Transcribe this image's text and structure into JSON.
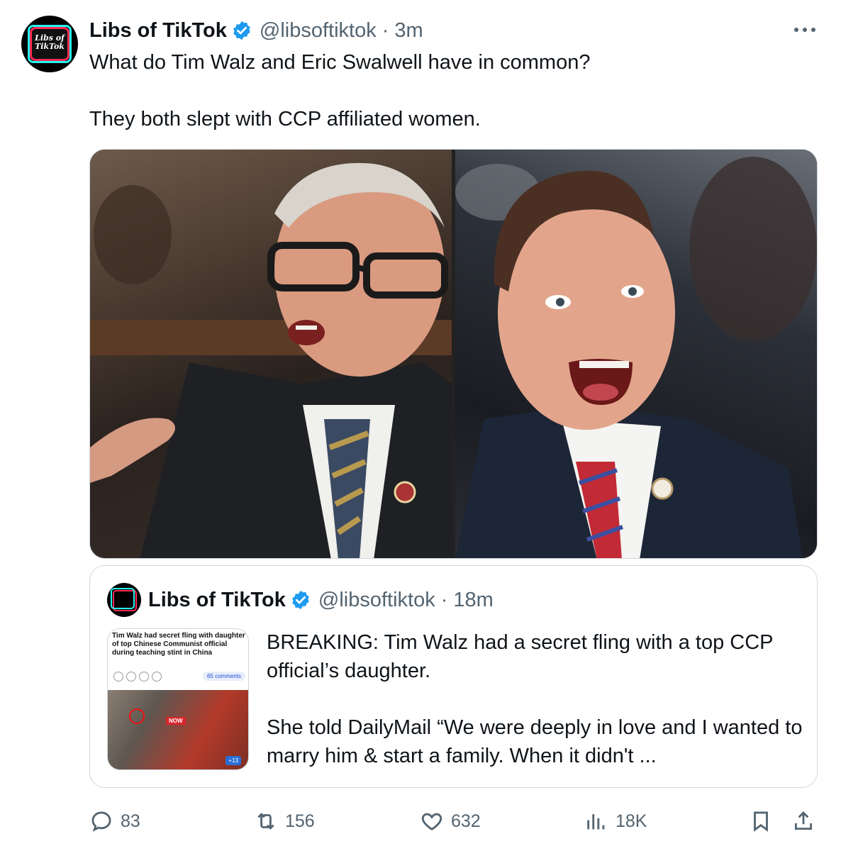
{
  "tweet": {
    "author_name": "Libs of TikTok",
    "handle": "@libsoftiktok",
    "separator": "·",
    "time": "3m",
    "avatar_text": "Libs of TikTok",
    "text_line1": "What do Tim Walz and Eric Swalwell have in common?",
    "text_line2": "They both slept with CCP affiliated women.",
    "more_icon": "more-horizontal-icon",
    "verified_color": "#1d9bf0"
  },
  "media": {
    "left_photo": "photo of a man with glasses in a suit speaking",
    "right_photo": "photo of a man in a suit laughing"
  },
  "quoted_tweet": {
    "author_name": "Libs of TikTok",
    "handle": "@libsoftiktok",
    "separator": "·",
    "time": "18m",
    "thumb_title": "Tim Walz had secret fling with daughter of top Chinese Communist official during teaching stint in China",
    "thumb_comments": "65 comments",
    "thumb_now": "NOW",
    "thumb_plus": "+13",
    "text_line1": "BREAKING: Tim Walz had a secret fling with a top CCP official’s daughter.",
    "text_line2": "She told DailyMail “We were deeply in love and I wanted to marry him & start a family. When it didn't ..."
  },
  "actions": {
    "replies": "83",
    "reposts": "156",
    "likes": "632",
    "views": "18K"
  }
}
